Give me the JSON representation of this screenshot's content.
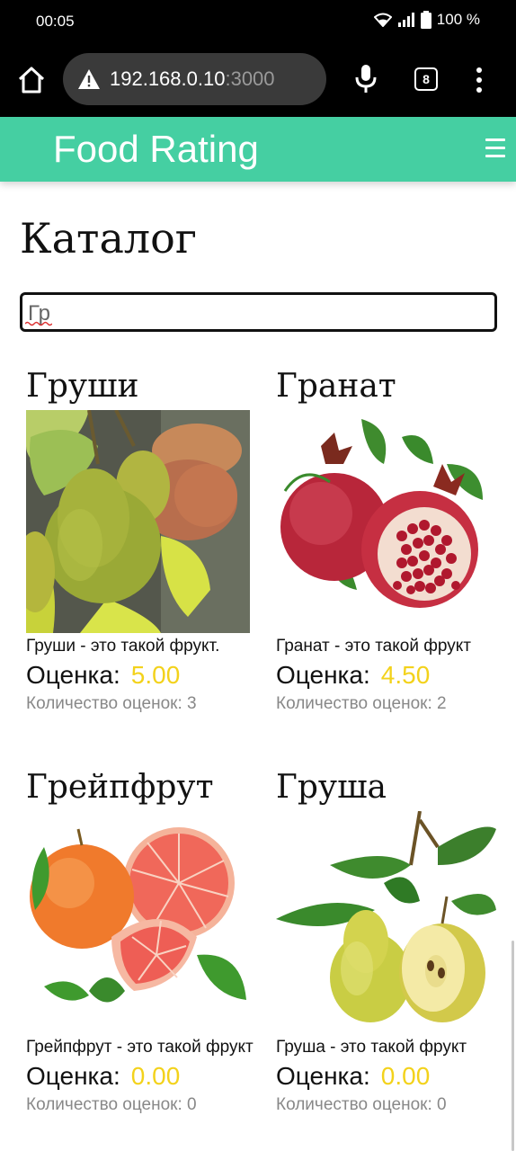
{
  "status_bar": {
    "time": "00:05",
    "battery": "100 %"
  },
  "browser": {
    "url_host": "192.168.0.10",
    "url_port": ":3000",
    "tab_count": "8"
  },
  "header": {
    "title": "Food Rating"
  },
  "page": {
    "title": "Каталог",
    "search": {
      "value": "Гр"
    }
  },
  "products": [
    {
      "name": "Груши",
      "description": "Груши - это такой фрукт.",
      "rating_label": "Оценка:",
      "rating": "5.00",
      "count_label": "Количество оценок: 3",
      "image": "pears-on-branch"
    },
    {
      "name": "Гранат",
      "description": "Гранат - это такой фрукт",
      "rating_label": "Оценка:",
      "rating": "4.50",
      "count_label": "Количество оценок: 2",
      "image": "pomegranate"
    },
    {
      "name": "Грейпфрут",
      "description": "Грейпфрут - это такой фрукт",
      "rating_label": "Оценка:",
      "rating": "0.00",
      "count_label": "Количество оценок: 0",
      "image": "grapefruit"
    },
    {
      "name": "Груша",
      "description": "Груша - это такой фрукт",
      "rating_label": "Оценка:",
      "rating": "0.00",
      "count_label": "Количество оценок: 0",
      "image": "pear-with-leaves"
    }
  ],
  "colors": {
    "accent": "#45cfa2",
    "rating": "#f3d21b"
  }
}
